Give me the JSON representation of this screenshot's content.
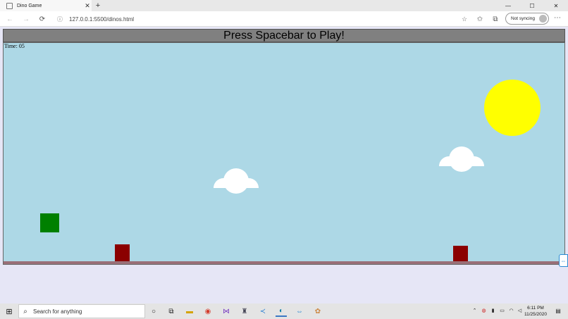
{
  "browser": {
    "tab_title": "Dino Game",
    "tab_close": "✕",
    "new_tab": "+",
    "window_controls": {
      "minimize": "—",
      "maximize": "☐",
      "close": "✕"
    },
    "nav": {
      "back": "←",
      "forward": "→",
      "refresh": "⟳",
      "info": "ⓘ"
    },
    "url": "127.0.0.1:5500/dinos.html",
    "icons": {
      "favorites_star": "☆",
      "favorites_bar": "✩",
      "collections": "⧉",
      "more": "⋯"
    },
    "sync_label": "Not syncing"
  },
  "game": {
    "header_text": "Press Spacebar to Play!",
    "timer_text": "Time: 05",
    "colors": {
      "sky": "#add8e6",
      "sun": "#ffff00",
      "player": "#008000",
      "obstacle": "#8b0000",
      "ground": "#9a7078",
      "header": "#808080"
    },
    "side_widget_icon": "⇔"
  },
  "taskbar": {
    "start_icon": "windows-logo-icon",
    "search_placeholder": "Search for anything",
    "glyphs": {
      "start": "⊞",
      "search": "⌕",
      "cortana": "○",
      "task_view": "⧉",
      "file_explorer": "▬",
      "chrome": "◉",
      "visual_studio": "⋈",
      "app_generic": "♜",
      "vscode": "≺",
      "edge": "◐",
      "teamviewer": "⇔",
      "app_paint": "✿",
      "tray_chevron": "⌃",
      "tray_shield": "◍",
      "tray_mic": "▮",
      "tray_battery": "▭",
      "tray_network": "◠",
      "tray_volume": "◁",
      "tray_language": "⌨",
      "notification": "▤"
    },
    "clock_time": "6:11 PM",
    "clock_date": "11/25/2020"
  }
}
